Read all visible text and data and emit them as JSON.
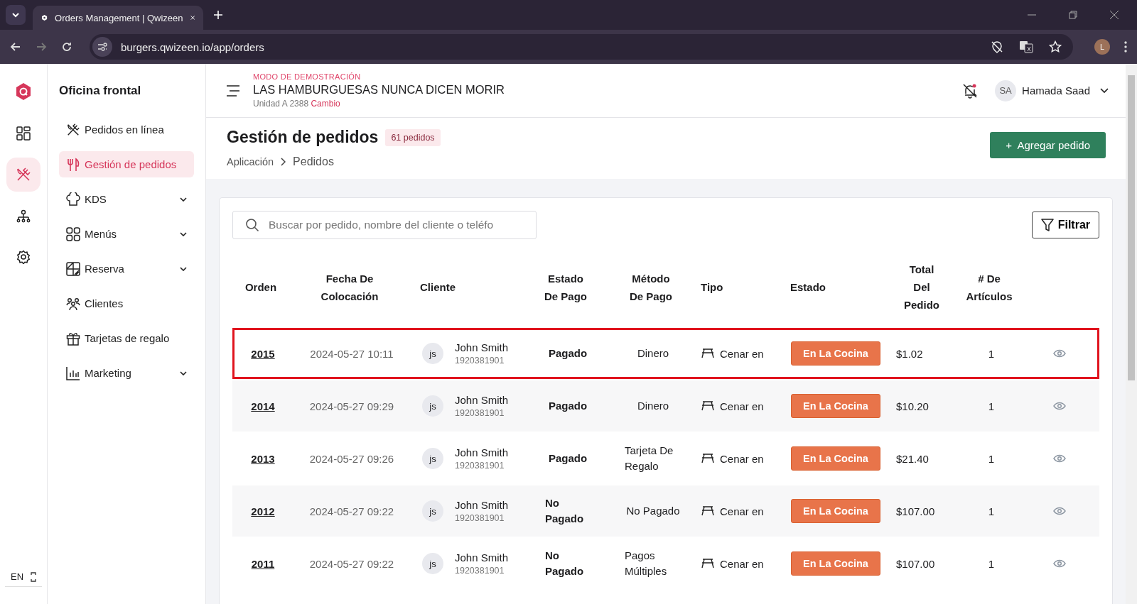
{
  "browser": {
    "tab_title": "Orders Management | Qwizeen",
    "url": "burgers.qwizeen.io/app/orders",
    "profile_initial": "L"
  },
  "rail": {
    "items": [
      {
        "kind": "dashboard",
        "selected": false
      },
      {
        "kind": "cutlery",
        "selected": true
      },
      {
        "kind": "hierarchy",
        "selected": false
      },
      {
        "kind": "settings",
        "selected": false
      }
    ],
    "language": "EN"
  },
  "sidebar": {
    "title": "Oficina frontal",
    "items": [
      {
        "label": "Pedidos en línea",
        "kind": "cutlery",
        "expandable": false,
        "selected": false
      },
      {
        "label": "Gestión de pedidos",
        "kind": "fork",
        "expandable": false,
        "selected": true
      },
      {
        "label": "KDS",
        "kind": "chef",
        "expandable": true,
        "selected": false
      },
      {
        "label": "Menús",
        "kind": "grid",
        "expandable": true,
        "selected": false
      },
      {
        "label": "Reserva",
        "kind": "table",
        "expandable": true,
        "selected": false
      },
      {
        "label": "Clientes",
        "kind": "people",
        "expandable": false,
        "selected": false
      },
      {
        "label": "Tarjetas de regalo",
        "kind": "gift",
        "expandable": false,
        "selected": false
      },
      {
        "label": "Marketing",
        "kind": "chart",
        "expandable": true,
        "selected": false
      }
    ]
  },
  "header": {
    "demo_label": "MODO DE DEMOSTRACIÓN",
    "restaurant": "LAS HAMBURGUESAS NUNCA DICEN MORIR",
    "unit": "Unidad A 2388",
    "change_link": "Cambio",
    "user": {
      "initials": "SA",
      "name": "Hamada Saad"
    }
  },
  "page": {
    "title": "Gestión de pedidos",
    "count_badge": "61 pedidos",
    "breadcrumb": [
      "Aplicación",
      "Pedidos"
    ],
    "add_button": "+  Agregar pedido"
  },
  "search": {
    "placeholder": "Buscar por pedido, nombre del cliente o teléfo"
  },
  "filter_button": "Filtrar",
  "table": {
    "columns": [
      [
        "Orden"
      ],
      [
        "Fecha De",
        "Colocación"
      ],
      [
        "Cliente"
      ],
      [
        "Estado",
        "De Pago"
      ],
      [
        "Método",
        "De Pago"
      ],
      [
        "Tipo"
      ],
      [
        "Estado"
      ],
      [
        "Total",
        "Del",
        "Pedido"
      ],
      [
        "# De",
        "Artículos"
      ]
    ],
    "rows": [
      {
        "order": "2015",
        "date": "2024-05-27 10:11",
        "initials": "js",
        "name": "John Smith",
        "phone": "1920381901",
        "payment_status": "Pagado",
        "payment_method": "Dinero",
        "type": "Cenar en",
        "status": "En La Cocina",
        "total": "$1.02",
        "items": "1",
        "highlighted": true
      },
      {
        "order": "2014",
        "date": "2024-05-27 09:29",
        "initials": "js",
        "name": "John Smith",
        "phone": "1920381901",
        "payment_status": "Pagado",
        "payment_method": "Dinero",
        "type": "Cenar en",
        "status": "En La Cocina",
        "total": "$10.20",
        "items": "1",
        "highlighted": false
      },
      {
        "order": "2013",
        "date": "2024-05-27 09:26",
        "initials": "js",
        "name": "John Smith",
        "phone": "1920381901",
        "payment_status": "Pagado",
        "payment_method": "Tarjeta De Regalo",
        "type": "Cenar en",
        "status": "En La Cocina",
        "total": "$21.40",
        "items": "1",
        "highlighted": false
      },
      {
        "order": "2012",
        "date": "2024-05-27 09:22",
        "initials": "js",
        "name": "John Smith",
        "phone": "1920381901",
        "payment_status": "No Pagado",
        "payment_method": "No Pagado",
        "type": "Cenar en",
        "status": "En La Cocina",
        "total": "$107.00",
        "items": "1",
        "highlighted": false
      },
      {
        "order": "2011",
        "date": "2024-05-27 09:22",
        "initials": "js",
        "name": "John Smith",
        "phone": "1920381901",
        "payment_status": "No Pagado",
        "payment_method": "Pagos Múltiples",
        "type": "Cenar en",
        "status": "En La Cocina",
        "total": "$107.00",
        "items": "1",
        "highlighted": false
      }
    ]
  }
}
